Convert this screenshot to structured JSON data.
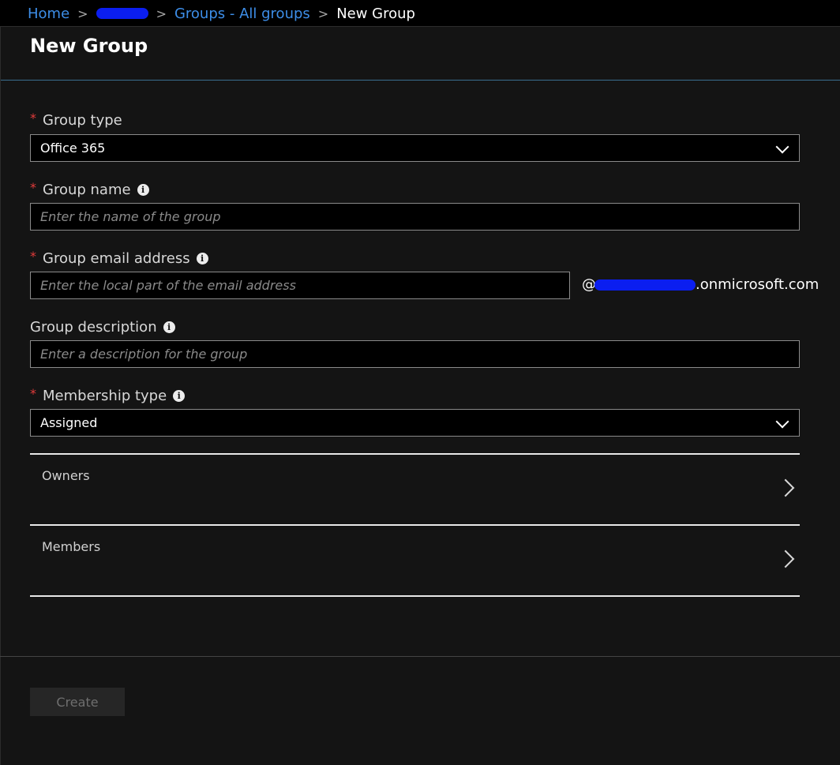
{
  "breadcrumb": {
    "home": "Home",
    "groups": "Groups - All groups",
    "current": "New Group"
  },
  "blade": {
    "title": "New Group"
  },
  "form": {
    "group_type": {
      "label": "Group type",
      "required": true,
      "value": "Office 365"
    },
    "group_name": {
      "label": "Group name",
      "required": true,
      "placeholder": "Enter the name of the group"
    },
    "group_email": {
      "label": "Group email address",
      "required": true,
      "placeholder": "Enter the local part of the email address",
      "suffix_at": "@",
      "suffix_domain": ".onmicrosoft.com"
    },
    "group_description": {
      "label": "Group description",
      "required": false,
      "placeholder": "Enter a description for the group"
    },
    "membership_type": {
      "label": "Membership type",
      "required": true,
      "value": "Assigned"
    }
  },
  "sections": {
    "owners": "Owners",
    "members": "Members"
  },
  "footer": {
    "create_label": "Create"
  },
  "colors": {
    "link": "#3d8ee8",
    "required": "#e23b3b",
    "redaction": "#0b1ef0",
    "background": "#141414"
  },
  "icons": {
    "info": "info-icon",
    "dropdown": "chevron-down-icon",
    "navigate": "chevron-right-icon"
  }
}
